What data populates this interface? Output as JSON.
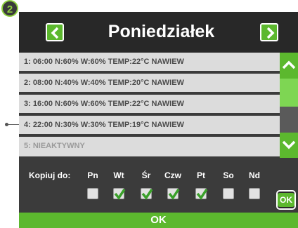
{
  "badge": "2",
  "header": {
    "title": "Poniedziałek",
    "prev_icon": "chevron-left-icon",
    "next_icon": "chevron-right-icon"
  },
  "program_list": [
    {
      "text": "1: 06:00  N:60%  W:60%  TEMP:22°C  NAWIEW",
      "active": true
    },
    {
      "text": "2: 08:00  N:40%  W:40%  TEMP:20°C  NAWIEW",
      "active": true
    },
    {
      "text": "3: 16:00  N:60%  W:60%  TEMP:22°C  NAWIEW",
      "active": true
    },
    {
      "text": "4: 22:00  N:30%  W:30%  TEMP:19°C  NAWIEW",
      "active": true
    },
    {
      "text": "5: NIEAKTYWNY",
      "active": false
    }
  ],
  "copy": {
    "label": "Kopiuj do:",
    "days": [
      {
        "name": "Pn",
        "checked": false
      },
      {
        "name": "Wt",
        "checked": true
      },
      {
        "name": "Śr",
        "checked": true
      },
      {
        "name": "Czw",
        "checked": true
      },
      {
        "name": "Pt",
        "checked": true
      },
      {
        "name": "So",
        "checked": false
      },
      {
        "name": "Nd",
        "checked": false
      }
    ],
    "ok_label": "OK"
  },
  "footer": {
    "ok_label": "OK"
  },
  "colors": {
    "accent": "#5cb82e",
    "panel": "#3b3b3b",
    "header": "#282828",
    "row": "#dcdcdc"
  }
}
